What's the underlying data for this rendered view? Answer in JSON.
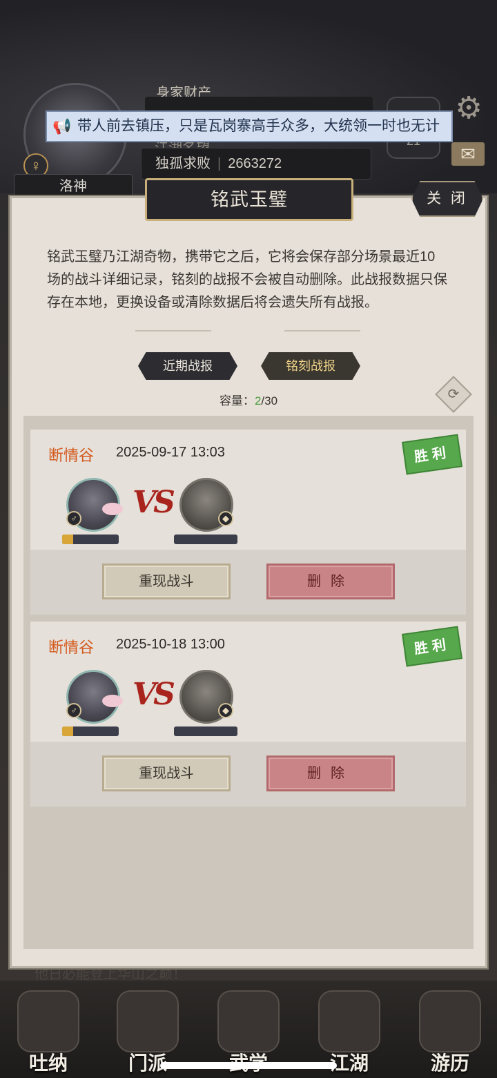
{
  "background": {
    "wealth_label": "身家财产",
    "fame_label": "江湖名望",
    "rank_title": "独孤求败",
    "rank_value": "2663272",
    "player_name": "洛神",
    "gender_symbol": "♀",
    "lantern_value": "21",
    "announcement": "带人前去镇压，只是瓦岗寨高手众多，大统领一时也无计",
    "story_line": "他日必能登上华山之巅！",
    "nav": [
      {
        "label": "吐纳"
      },
      {
        "label": "门派"
      },
      {
        "label": "武学"
      },
      {
        "label": "江湖"
      },
      {
        "label": "游历"
      }
    ]
  },
  "dialog": {
    "title": "铭武玉璧",
    "close_label": "关 闭",
    "description": "铭武玉璧乃江湖奇物，携带它之后，它将会保存部分场景最近10场的战斗详细记录，铭刻的战报不会被自动删除。此战报数据只保存在本地，更换设备或清除数据后将会遗失所有战报。",
    "tabs": {
      "recent": "近期战报",
      "engraved": "铭刻战报"
    },
    "capacity": {
      "label": "容量：",
      "used": "2",
      "total": "/30"
    },
    "reports": [
      {
        "location": "断情谷",
        "time": "2025-09-17 13:03",
        "result": "胜利",
        "vs_label": "VS",
        "player_hp": 0.2,
        "enemy_hp": 0,
        "replay_label": "重现战斗",
        "delete_label": "删除"
      },
      {
        "location": "断情谷",
        "time": "2025-10-18 13:00",
        "result": "胜利",
        "vs_label": "VS",
        "player_hp": 0.2,
        "enemy_hp": 0,
        "replay_label": "重现战斗",
        "delete_label": "删除"
      }
    ]
  },
  "colors": {
    "location": "#d45a1e",
    "victory_stamp": "#57a84c",
    "delete_button": "#c88486",
    "capacity_used": "#4a9a3c"
  }
}
